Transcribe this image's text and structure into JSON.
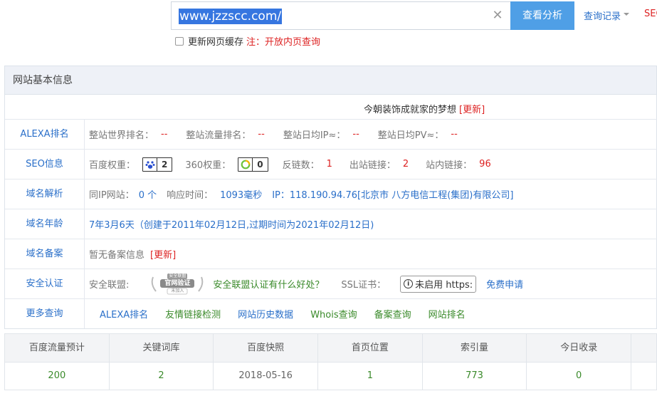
{
  "search": {
    "query": "www.jzzscc.com/",
    "button_label": "查看分析",
    "history_label": "查询记录",
    "seo_cut": "SEO"
  },
  "cache": {
    "label": "更新网页缓存",
    "note": "注：开放内页查询"
  },
  "panel": {
    "title": "网站基本信息",
    "tagline": "今朝装饰成就家的梦想",
    "tagline_update": "[更新]"
  },
  "alexa": {
    "label": "ALEXA排名",
    "world_label": "整站世界排名：",
    "world_value": "--",
    "traffic_label": "整站流量排名：",
    "traffic_value": "--",
    "ip_label": "整站日均IP≈：",
    "ip_value": "--",
    "pv_label": "整站日均PV≈：",
    "pv_value": "--"
  },
  "seo": {
    "label": "SEO信息",
    "baidu_label": "百度权重：",
    "baidu_value": "2",
    "q360_label": "360权重：",
    "q360_value": "0",
    "backlink_label": "反链数：",
    "backlink_value": "1",
    "outlink_label": "出站链接：",
    "outlink_value": "2",
    "inlink_label": "站内链接：",
    "inlink_value": "96"
  },
  "dns": {
    "label": "域名解析",
    "same_ip_label": "同IP网站：",
    "same_ip_value": "0 个",
    "resp_label": "响应时间：",
    "resp_value": "1093毫秒",
    "ip_text": "IP：118.190.94.76[北京市 八方电信工程(集团)有限公司]"
  },
  "age": {
    "label": "域名年龄",
    "text": "7年3月6天（创建于2011年02月12日,过期时间为2021年02月12日)"
  },
  "icp": {
    "label": "域名备案",
    "text": "暂无备案信息",
    "update": "[更新]"
  },
  "security": {
    "label": "安全认证",
    "alliance_label": "安全联盟:",
    "seal_top": "安全联盟",
    "seal_main": "官网验证",
    "seal_sub": "未加入",
    "benefit_link": "安全联盟认证有什么好处？",
    "ssl_label": "SSL证书：",
    "ssl_status": "未启用 https:",
    "free_apply": "免费申请"
  },
  "more": {
    "label": "更多查询",
    "links": [
      "ALEXA排名",
      "友情链接检测",
      "网站历史数据",
      "Whois查询",
      "备案查询",
      "网站排名"
    ]
  },
  "stats": {
    "headers": [
      "百度流量预计",
      "关键词库",
      "百度快照",
      "首页位置",
      "索引量",
      "今日收录"
    ],
    "values": [
      "200",
      "2",
      "2018-05-16",
      "1",
      "773",
      "0"
    ]
  },
  "colors": {
    "accent": "#4f9fe6",
    "link": "#2a6fc9",
    "alert": "#dd2222",
    "green": "#3a8a2a"
  }
}
